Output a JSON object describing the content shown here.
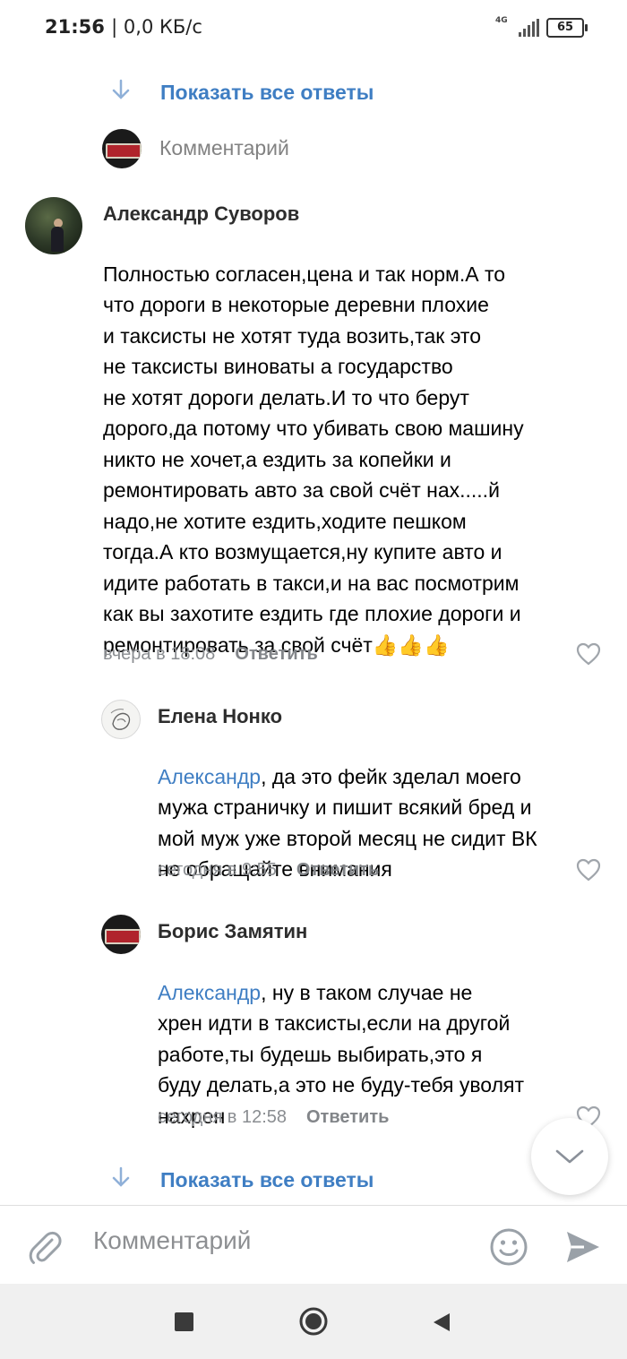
{
  "status_bar": {
    "time": "21:56",
    "speed": "| 0,0 КБ/с",
    "network": "4G",
    "battery": "65"
  },
  "top_show_replies": {
    "label": "Показать все ответы"
  },
  "top_comment_field": {
    "placeholder": "Комментарий"
  },
  "comments": [
    {
      "author": "Александр Суворов",
      "text": "Полностью согласен,цена и так норм.А то\nчто дороги в некоторые деревни плохие\nи таксисты не хотят туда возить,так это\nне таксисты виноваты а государство\nне хотят дороги делать.И то что берут\nдорого,да потому что убивать свою машину\nникто не хочет,а ездить за копейки и\nремонтировать авто за свой счёт нах.....й\nнадо,не хотите ездить,ходите пешком\nтогда.А кто возмущается,ну купите авто и\nидите работать в такси,и на вас посмотрим\nкак вы захотите ездить где плохие дороги и\nремонтировать за свой счёт",
      "emoji": "👍👍👍",
      "time": "вчера в 18:08",
      "reply_label": "Ответить"
    },
    {
      "author": "Елена Нонко",
      "mention": "Александр",
      "text": ", да это фейк зделал моего\nмужа страничку и пишит всякий бред и\nмой муж уже второй месяц не сидит ВК\nне обращайте внимания",
      "time": "сегодня в 9:55",
      "reply_label": "Ответить"
    },
    {
      "author": "Борис Замятин",
      "mention": "Александр",
      "text": ", ну в таком случае не\nхрен идти в таксисты,если на другой\nработе,ты будешь выбирать,это я\nбуду делать,а это не буду-тебя уволят\nнахрен",
      "time": "сегодня в 12:58",
      "reply_label": "Ответить"
    }
  ],
  "bottom_show_replies": {
    "label": "Показать все ответы"
  },
  "composer": {
    "placeholder": "Комментарий"
  },
  "avatar_brand_text": "БЕРУ ВЫХОДНОЙ",
  "colors": {
    "link": "#3f7ec3",
    "meta": "#8a8d91",
    "icon": "#9aa1a8"
  },
  "icons": [
    "arrow-down-icon",
    "heart-icon",
    "chevron-down-icon",
    "attach-icon",
    "emoji-icon",
    "send-icon",
    "nav-square-icon",
    "nav-home-icon",
    "nav-back-icon"
  ]
}
